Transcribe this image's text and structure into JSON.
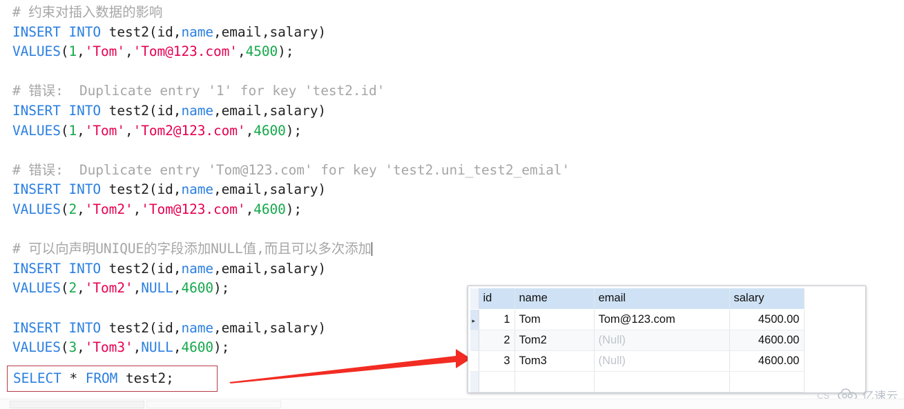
{
  "editor": {
    "lines": [
      [
        {
          "t": "# 约束对插入数据的影响",
          "c": "cmt"
        }
      ],
      [
        {
          "t": "INSERT INTO",
          "c": "kw"
        },
        {
          "t": " test2(id,",
          "c": "ident"
        },
        {
          "t": "name",
          "c": "kw"
        },
        {
          "t": ",email,salary)",
          "c": "ident"
        }
      ],
      [
        {
          "t": "VALUES",
          "c": "kw"
        },
        {
          "t": "(",
          "c": "punc"
        },
        {
          "t": "1",
          "c": "num"
        },
        {
          "t": ",",
          "c": "punc"
        },
        {
          "t": "'Tom'",
          "c": "str"
        },
        {
          "t": ",",
          "c": "punc"
        },
        {
          "t": "'Tom@123.com'",
          "c": "str"
        },
        {
          "t": ",",
          "c": "punc"
        },
        {
          "t": "4500",
          "c": "num"
        },
        {
          "t": ");",
          "c": "punc"
        }
      ],
      [
        {
          "t": " ",
          "c": "blank"
        }
      ],
      [
        {
          "t": "# 错误:  Duplicate entry '1' for key 'test2.id'",
          "c": "cmt"
        }
      ],
      [
        {
          "t": "INSERT INTO",
          "c": "kw"
        },
        {
          "t": " test2(id,",
          "c": "ident"
        },
        {
          "t": "name",
          "c": "kw"
        },
        {
          "t": ",email,salary)",
          "c": "ident"
        }
      ],
      [
        {
          "t": "VALUES",
          "c": "kw"
        },
        {
          "t": "(",
          "c": "punc"
        },
        {
          "t": "1",
          "c": "num"
        },
        {
          "t": ",",
          "c": "punc"
        },
        {
          "t": "'Tom'",
          "c": "str"
        },
        {
          "t": ",",
          "c": "punc"
        },
        {
          "t": "'Tom2@123.com'",
          "c": "str"
        },
        {
          "t": ",",
          "c": "punc"
        },
        {
          "t": "4600",
          "c": "num"
        },
        {
          "t": ");",
          "c": "punc"
        }
      ],
      [
        {
          "t": " ",
          "c": "blank"
        }
      ],
      [
        {
          "t": "# 错误:  Duplicate entry 'Tom@123.com' for key 'test2.uni_test2_emial'",
          "c": "cmt"
        }
      ],
      [
        {
          "t": "INSERT INTO",
          "c": "kw"
        },
        {
          "t": " test2(id,",
          "c": "ident"
        },
        {
          "t": "name",
          "c": "kw"
        },
        {
          "t": ",email,salary)",
          "c": "ident"
        }
      ],
      [
        {
          "t": "VALUES",
          "c": "kw"
        },
        {
          "t": "(",
          "c": "punc"
        },
        {
          "t": "2",
          "c": "num"
        },
        {
          "t": ",",
          "c": "punc"
        },
        {
          "t": "'Tom2'",
          "c": "str"
        },
        {
          "t": ",",
          "c": "punc"
        },
        {
          "t": "'Tom@123.com'",
          "c": "str"
        },
        {
          "t": ",",
          "c": "punc"
        },
        {
          "t": "4600",
          "c": "num"
        },
        {
          "t": ");",
          "c": "punc"
        }
      ],
      [
        {
          "t": " ",
          "c": "blank"
        }
      ],
      [
        {
          "t": "# 可以向声明UNIQUE的字段添加NULL值,而且可以多次添加",
          "c": "cmt",
          "caret": true
        }
      ],
      [
        {
          "t": "INSERT INTO",
          "c": "kw"
        },
        {
          "t": " test2(id,",
          "c": "ident"
        },
        {
          "t": "name",
          "c": "kw"
        },
        {
          "t": ",email,salary)",
          "c": "ident"
        }
      ],
      [
        {
          "t": "VALUES",
          "c": "kw"
        },
        {
          "t": "(",
          "c": "punc"
        },
        {
          "t": "2",
          "c": "num"
        },
        {
          "t": ",",
          "c": "punc"
        },
        {
          "t": "'Tom2'",
          "c": "str"
        },
        {
          "t": ",",
          "c": "punc"
        },
        {
          "t": "NULL",
          "c": "kw"
        },
        {
          "t": ",",
          "c": "punc"
        },
        {
          "t": "4600",
          "c": "num"
        },
        {
          "t": ");",
          "c": "punc"
        }
      ],
      [
        {
          "t": " ",
          "c": "blank"
        }
      ],
      [
        {
          "t": "INSERT INTO",
          "c": "kw"
        },
        {
          "t": " test2(id,",
          "c": "ident"
        },
        {
          "t": "name",
          "c": "kw"
        },
        {
          "t": ",email,salary)",
          "c": "ident"
        }
      ],
      [
        {
          "t": "VALUES",
          "c": "kw"
        },
        {
          "t": "(",
          "c": "punc"
        },
        {
          "t": "3",
          "c": "num"
        },
        {
          "t": ",",
          "c": "punc"
        },
        {
          "t": "'Tom3'",
          "c": "str"
        },
        {
          "t": ",",
          "c": "punc"
        },
        {
          "t": "NULL",
          "c": "kw"
        },
        {
          "t": ",",
          "c": "punc"
        },
        {
          "t": "4600",
          "c": "num"
        },
        {
          "t": ");",
          "c": "punc"
        }
      ]
    ],
    "select_statement": [
      {
        "t": "SELECT",
        "c": "kw"
      },
      {
        "t": " ",
        "c": "ident"
      },
      {
        "t": "*",
        "c": "punc"
      },
      {
        "t": " ",
        "c": "ident"
      },
      {
        "t": "FROM",
        "c": "kw"
      },
      {
        "t": " test2;",
        "c": "ident"
      }
    ]
  },
  "annotation": {
    "arrow_color": "#f22c22",
    "highlight_box_color": "#b63a45",
    "arrow_name": "red-arrow-annotation"
  },
  "result_grid": {
    "row_marker": "▸",
    "columns": [
      "id",
      "name",
      "email",
      "salary"
    ],
    "rows": [
      {
        "id": "1",
        "name": "Tom",
        "email": "Tom@123.com",
        "salary": "4500.00",
        "email_null": false,
        "selected": true
      },
      {
        "id": "2",
        "name": "Tom2",
        "email": "(Null)",
        "salary": "4600.00",
        "email_null": true,
        "selected": false
      },
      {
        "id": "3",
        "name": "Tom3",
        "email": "(Null)",
        "salary": "4600.00",
        "email_null": true,
        "selected": false
      }
    ],
    "header_bg": "#cfe2f5"
  },
  "watermark": {
    "cs_text": "CS",
    "brand_text": "亿速云",
    "icon": "cloud-icon"
  }
}
